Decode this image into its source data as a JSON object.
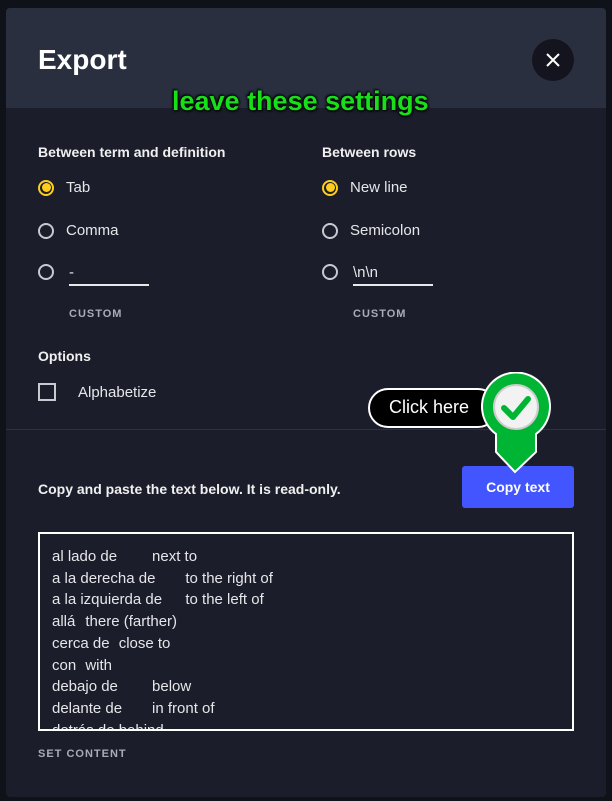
{
  "dialog": {
    "title": "Export",
    "close_icon": "close-icon",
    "annotation": "leave these settings",
    "term_definition": {
      "label": "Between term and definition",
      "options": [
        "Tab",
        "Comma"
      ],
      "selected": "Tab",
      "custom_value": "-",
      "custom_label": "CUSTOM"
    },
    "rows": {
      "label": "Between rows",
      "options": [
        "New line",
        "Semicolon"
      ],
      "selected": "New line",
      "custom_value": "\\n\\n",
      "custom_label": "CUSTOM"
    },
    "options": {
      "label": "Options",
      "alphabetize": "Alphabetize",
      "alphabetize_checked": false
    },
    "copy_instruction": "Copy and paste the text below. It is read-only.",
    "copy_button": "Copy text",
    "callout": "Click here",
    "export_text": "al lado de\tnext to\na la derecha de\tto the right of\na la izquierda de\tto the left of\nallá\tthere (farther)\ncerca de\tclose to\ncon\twith\ndebajo de\tbelow\ndelante de\tin front of\ndetrás de\tbehind",
    "set_content": "SET CONTENT"
  },
  "colors": {
    "accent": "#ffcd1f",
    "button": "#4255ff",
    "annotation": "#18e018"
  }
}
